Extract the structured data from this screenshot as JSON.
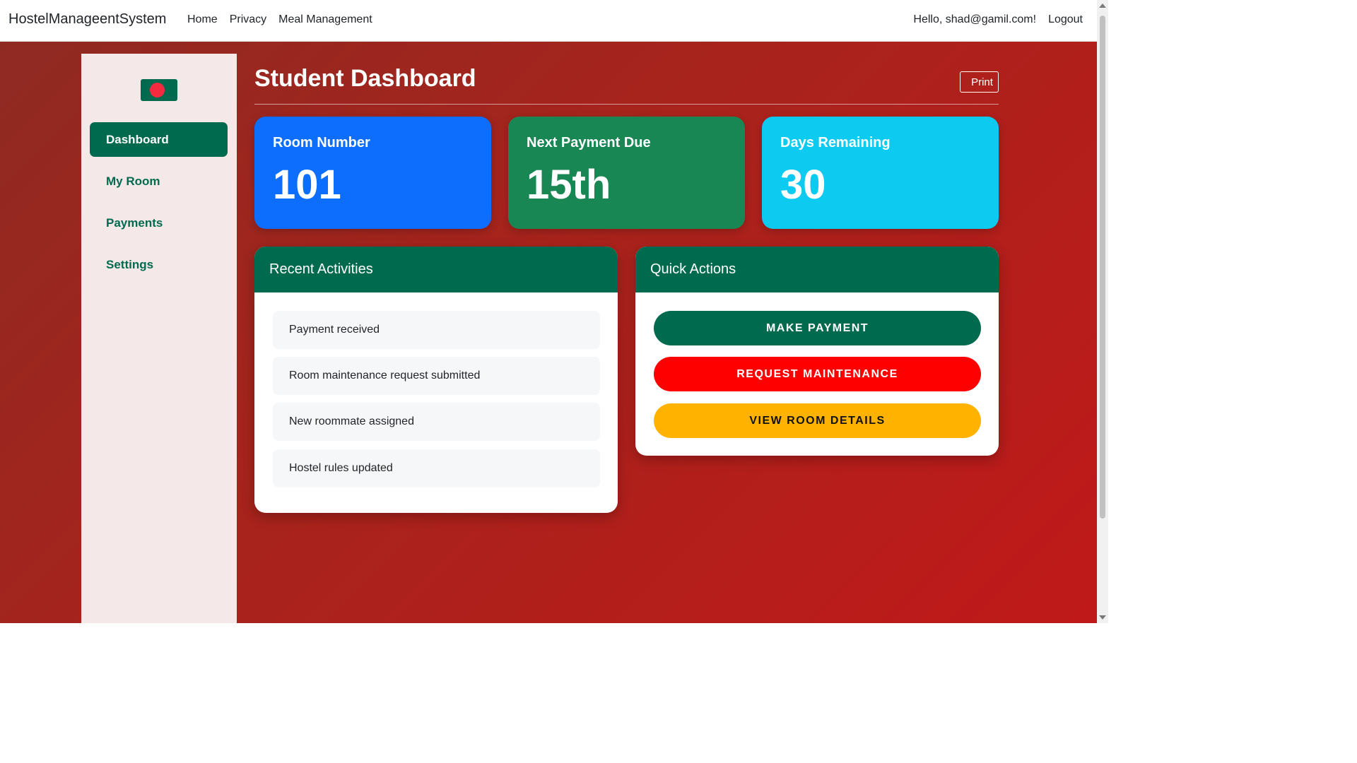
{
  "navbar": {
    "brand": "HostelManageentSystem",
    "links": [
      "Home",
      "Privacy",
      "Meal Management"
    ],
    "greeting": "Hello, shad@gamil.com!",
    "logout": "Logout"
  },
  "sidebar": {
    "items": [
      {
        "label": "Dashboard",
        "active": true
      },
      {
        "label": "My Room",
        "active": false
      },
      {
        "label": "Payments",
        "active": false
      },
      {
        "label": "Settings",
        "active": false
      }
    ]
  },
  "main": {
    "title": "Student Dashboard",
    "print_label": "Print",
    "stats": [
      {
        "label": "Room Number",
        "value": "101",
        "color": "#0d6efd"
      },
      {
        "label": "Next Payment Due",
        "value": "15th",
        "color": "#198754"
      },
      {
        "label": "Days Remaining",
        "value": "30",
        "color": "#0dcaf0"
      }
    ],
    "recent": {
      "title": "Recent Activities",
      "items": [
        "Payment received",
        "Room maintenance request submitted",
        "New roommate assigned",
        "Hostel rules updated"
      ]
    },
    "quick": {
      "title": "Quick Actions",
      "buttons": [
        {
          "label": "MAKE PAYMENT",
          "color": "#006a4e"
        },
        {
          "label": "REQUEST MAINTENANCE",
          "color": "#ff0000"
        },
        {
          "label": "VIEW ROOM DETAILS",
          "color": "#ffb300"
        }
      ]
    }
  },
  "colors": {
    "primary_green": "#006a4e",
    "flag_red": "#f42a41",
    "sidebar_bg": "#f5e8e8"
  }
}
